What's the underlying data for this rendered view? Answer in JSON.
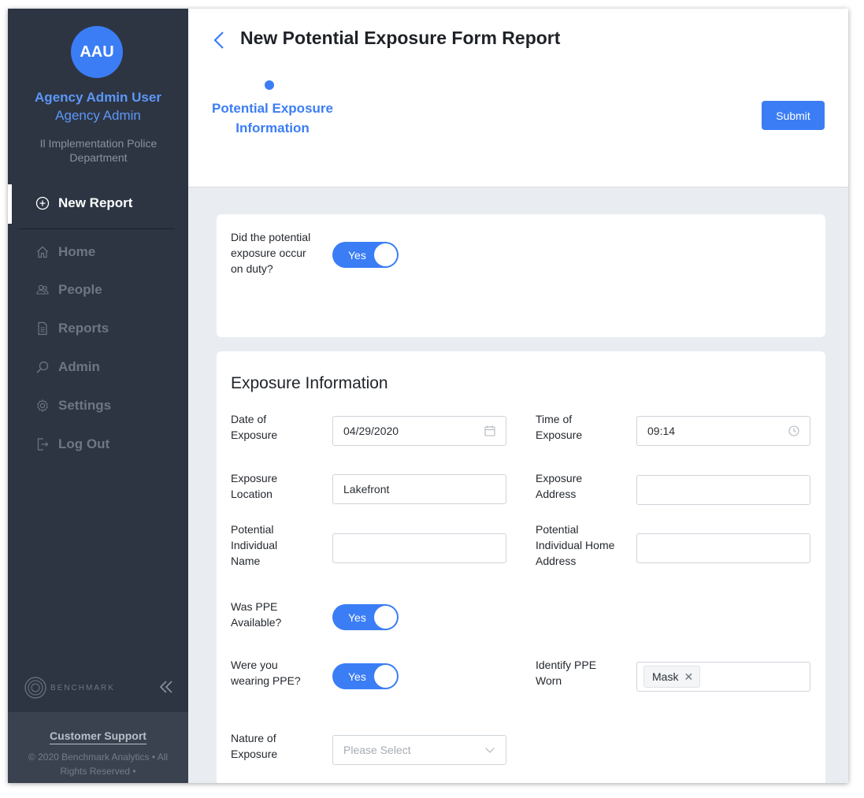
{
  "sidebar": {
    "avatar_initials": "AAU",
    "user_name": "Agency Admin User",
    "user_role": "Agency Admin",
    "agency_name": "Il Implementation Police Department",
    "nav": {
      "new_report": "New Report",
      "home": "Home",
      "people": "People",
      "reports": "Reports",
      "admin": "Admin",
      "settings": "Settings",
      "logout": "Log Out"
    },
    "brand": "BENCHMARK",
    "support": "Customer Support",
    "copyright": "© 2020 Benchmark Analytics • All Rights Reserved •"
  },
  "header": {
    "title": "New Potential Exposure Form Report",
    "step_label": "Potential Exposure Information",
    "submit_label": "Submit"
  },
  "form": {
    "on_duty": {
      "label": "Did the potential exposure occur on duty?",
      "value": "Yes"
    },
    "section_title": "Exposure Information",
    "date_of_exposure": {
      "label": "Date of Exposure",
      "value": "04/29/2020"
    },
    "time_of_exposure": {
      "label": "Time of Exposure",
      "value": "09:14"
    },
    "exposure_location": {
      "label": "Exposure Location",
      "value": "Lakefront"
    },
    "exposure_address": {
      "label": "Exposure Address",
      "value": ""
    },
    "individual_name": {
      "label": "Potential Individual Name",
      "value": ""
    },
    "individual_address": {
      "label": "Potential Individual Home Address",
      "value": ""
    },
    "ppe_available": {
      "label": "Was PPE Available?",
      "value": "Yes"
    },
    "wearing_ppe": {
      "label": "Were you wearing PPE?",
      "value": "Yes"
    },
    "ppe_worn": {
      "label": "Identify PPE Worn",
      "tags": [
        "Mask"
      ]
    },
    "nature": {
      "label": "Nature of Exposure",
      "placeholder": "Please Select"
    }
  },
  "colors": {
    "accent": "#3b7df5",
    "sidebar_bg": "#2d3543",
    "page_bg": "#e9edf1"
  }
}
